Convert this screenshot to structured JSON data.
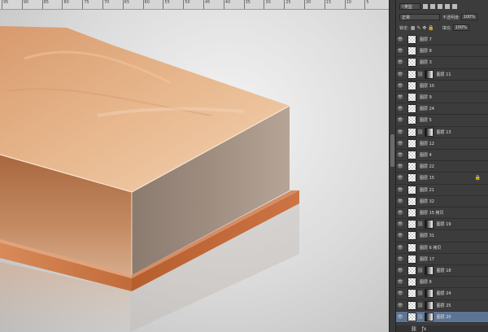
{
  "ruler": {
    "ticks": [
      "95",
      "90",
      "85",
      "80",
      "75",
      "70",
      "65",
      "60",
      "55",
      "50",
      "45",
      "40",
      "35",
      "30",
      "25",
      "20",
      "15",
      "10",
      "5"
    ]
  },
  "layers_panel": {
    "filter_kind": "类型",
    "blend_mode": "正常",
    "opacity_label": "不透明度:",
    "opacity_value": "100%",
    "lock_label": "锁定:",
    "fill_label": "填充:",
    "fill_value": "100%",
    "layers": [
      {
        "name": "图层 7",
        "mask": false,
        "locked": false
      },
      {
        "name": "图层 8",
        "mask": false,
        "locked": false
      },
      {
        "name": "图层 3",
        "mask": false,
        "locked": false
      },
      {
        "name": "图层 11",
        "mask": true,
        "locked": false
      },
      {
        "name": "图层 10",
        "mask": false,
        "locked": false
      },
      {
        "name": "图层 9",
        "mask": false,
        "locked": false
      },
      {
        "name": "图层 24",
        "mask": false,
        "locked": false
      },
      {
        "name": "图层 5",
        "mask": false,
        "locked": false
      },
      {
        "name": "图层 13",
        "mask": true,
        "locked": false
      },
      {
        "name": "图层 12",
        "mask": false,
        "locked": false
      },
      {
        "name": "图层 4",
        "mask": false,
        "locked": false
      },
      {
        "name": "图层 22",
        "mask": false,
        "locked": false
      },
      {
        "name": "图层 15",
        "mask": false,
        "locked": true
      },
      {
        "name": "图层 21",
        "mask": false,
        "locked": false
      },
      {
        "name": "图层 32",
        "mask": false,
        "locked": false
      },
      {
        "name": "图层 15 拷贝",
        "mask": false,
        "locked": false
      },
      {
        "name": "图层 19",
        "mask": true,
        "locked": false
      },
      {
        "name": "图层 31",
        "mask": false,
        "locked": false
      },
      {
        "name": "图层 6 拷贝",
        "mask": false,
        "locked": false
      },
      {
        "name": "图层 17",
        "mask": false,
        "locked": false
      },
      {
        "name": "图层 18",
        "mask": true,
        "locked": false
      },
      {
        "name": "图层 6",
        "mask": false,
        "locked": false
      },
      {
        "name": "图层 24",
        "mask": true,
        "locked": false
      },
      {
        "name": "图层 25",
        "mask": true,
        "locked": false
      },
      {
        "name": "图层 20",
        "mask": true,
        "locked": false,
        "selected": true
      }
    ],
    "bottom_icons": [
      "link-icon",
      "fx-icon"
    ]
  }
}
